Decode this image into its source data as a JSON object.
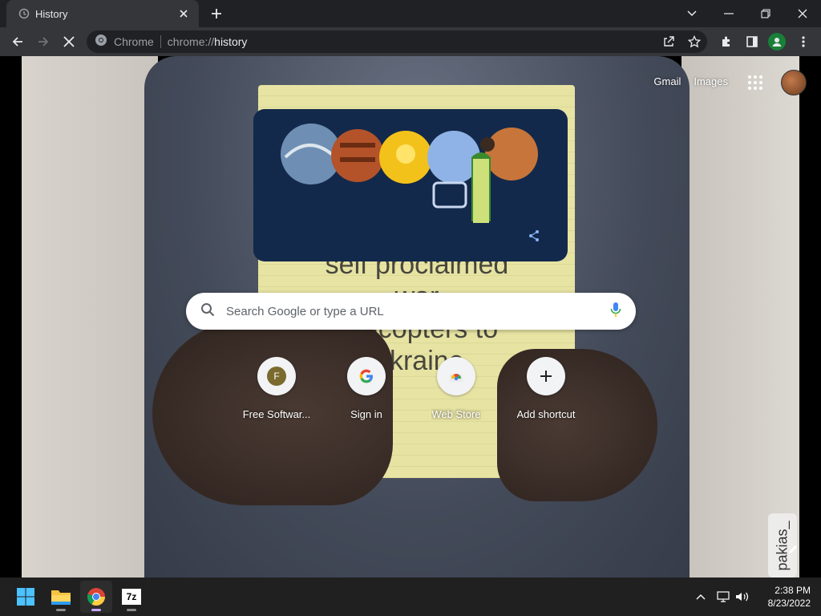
{
  "tab": {
    "title": "History",
    "favicon": "history-icon"
  },
  "toolbar": {
    "scheme_label": "Chrome",
    "url_scheme": "chrome://",
    "url_host": "history",
    "avatar_color": "#188038"
  },
  "ntp": {
    "top_links": {
      "gmail": "Gmail",
      "images": "Images"
    },
    "doodle_text": "",
    "paper_text": [
      "self proclaimed",
      "war",
      "helicopters to",
      "Ukraine"
    ],
    "watermark": "pakias_",
    "search": {
      "placeholder": "Search Google or type a URL"
    },
    "shortcuts": [
      {
        "label": "Free Softwar...",
        "icon_letter": "F",
        "icon_color": "#7a6a2e"
      },
      {
        "label": "Sign in",
        "icon": "google-g-icon"
      },
      {
        "label": "Web Store",
        "icon": "web-store-icon"
      },
      {
        "label": "Add shortcut",
        "icon": "plus-icon"
      }
    ]
  },
  "taskbar": {
    "clock_time": "2:38 PM",
    "clock_date": "8/23/2022",
    "apps": [
      "start-icon",
      "file-explorer-icon",
      "chrome-icon",
      "7zip-icon"
    ],
    "zip_label": "7z"
  },
  "colors": {
    "tabstrip": "#202124",
    "toolbar": "#35363a",
    "doodle_bg": "#13294b",
    "accent_blue": "#8ab4f8"
  }
}
